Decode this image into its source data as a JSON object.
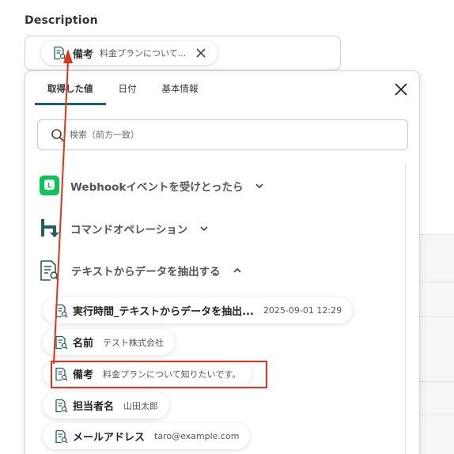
{
  "description": {
    "label": "Description",
    "chip": {
      "key": "備考",
      "value": "料金プランについて..."
    }
  },
  "popup": {
    "tabs": [
      "取得した値",
      "日付",
      "基本情報"
    ],
    "search_placeholder": "検索（前方一致）",
    "sections": [
      {
        "title": "Webhookイベントを受けとったら",
        "icon": "line-app-icon",
        "expanded": false
      },
      {
        "title": "コマンドオペレーション",
        "icon": "command-operation-icon",
        "expanded": false
      },
      {
        "title": "テキストからデータを抽出する",
        "icon": "document-search-icon",
        "expanded": true
      }
    ],
    "items": [
      {
        "key": "実行時間_テキストからデータを抽出...",
        "value": "2025-09-01 12:29"
      },
      {
        "key": "名前",
        "value": "テスト株式会社"
      },
      {
        "key": "備考",
        "value": "料金プランについて知りたいです。"
      },
      {
        "key": "担当者名",
        "value": "山田太郎"
      },
      {
        "key": "メールアドレス",
        "value": "taro@example.com"
      }
    ]
  },
  "colors": {
    "accent": "#1f5e6e",
    "annotation": "#e63312",
    "line_green": "#06c755",
    "command_teal": "#1f5e6e"
  }
}
